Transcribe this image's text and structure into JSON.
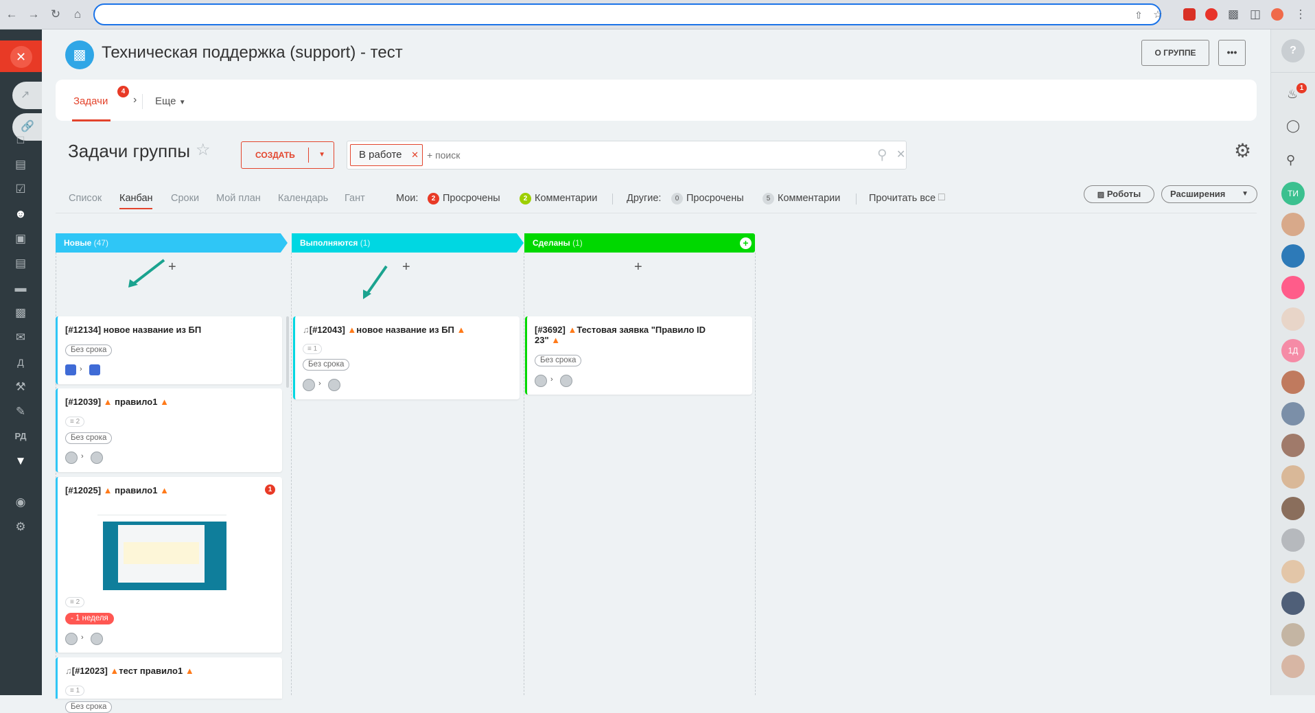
{
  "group": {
    "title": "Техническая поддержка (support) - тест",
    "about_button": "О ГРУППЕ",
    "more_button": "•••"
  },
  "nav": {
    "tasks_tab": "Задачи",
    "tasks_count": "4",
    "more_tab": "Еще"
  },
  "page": {
    "title": "Задачи группы",
    "create_button": "СОЗДАТЬ",
    "filter_chip": "В работе",
    "search_placeholder": "+ поиск"
  },
  "views": {
    "items": [
      "Список",
      "Канбан",
      "Сроки",
      "Мой план",
      "Календарь",
      "Гант"
    ],
    "active": "Канбан",
    "mine_label": "Мои:",
    "mine_overdue_count": "2",
    "mine_overdue": "Просрочены",
    "mine_comments_count": "2",
    "mine_comments": "Комментарии",
    "others_label": "Другие:",
    "others_overdue_count": "0",
    "others_overdue": "Просрочены",
    "others_comments_count": "5",
    "others_comments": "Комментарии",
    "read_all": "Прочитать все",
    "robots_button": "Роботы",
    "extensions_button": "Расширения"
  },
  "columns": [
    {
      "name": "Новые",
      "count": "(47)",
      "color": "#2fc6f6"
    },
    {
      "name": "Выполняются",
      "count": "(1)",
      "color": "#00d7e2"
    },
    {
      "name": "Сделаны",
      "count": "(1)",
      "color": "#00d800"
    }
  ],
  "cards": {
    "c1": {
      "title": "[#12134] новое название из БП",
      "deadline": "Без срока"
    },
    "c2": {
      "title": "[#12039]",
      "title_rest": "правило1",
      "checklist": "2",
      "deadline": "Без срока"
    },
    "c3": {
      "title": "[#12025]",
      "title_rest": "правило1",
      "badge": "1",
      "checklist": "2",
      "deadline": "- 1 неделя"
    },
    "c4": {
      "title": "[#12023]",
      "title_rest": "тест правило1",
      "checklist": "1",
      "deadline": "Без срока"
    },
    "c5": {
      "title": "[#12043]",
      "title_rest": "новое название из БП",
      "checklist": "1",
      "deadline": "Без срока"
    },
    "c6": {
      "title": "[#3692]",
      "title_rest": "Тестовая заявка \"Правило ID",
      "title_line2": "23\"",
      "deadline": "Без срока"
    }
  },
  "left_sidebar": {
    "letter_d": "Д",
    "letters_rd": "РД"
  },
  "right_sidebar": {
    "notif_count": "1",
    "avatar_ti": "ТИ",
    "avatar_1d": "1Д"
  },
  "icons": {
    "star": "star-icon",
    "gear": "gear-icon",
    "search": "search-icon",
    "fire": "fire-icon"
  }
}
